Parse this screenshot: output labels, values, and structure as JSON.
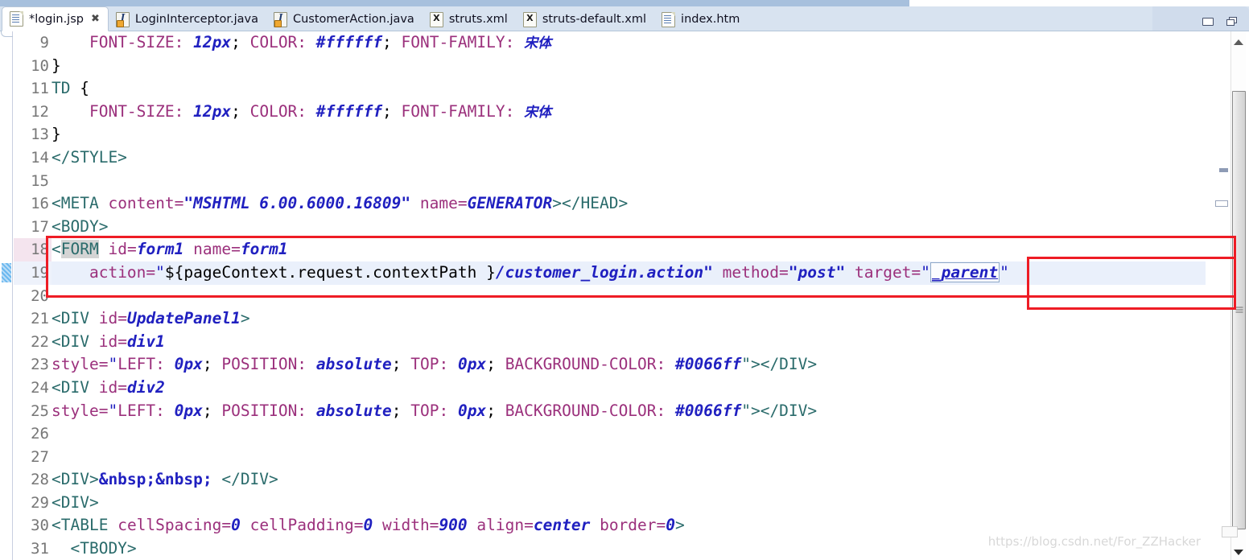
{
  "window": {
    "minimize_label": "Minimize",
    "maximize_label": "Restore"
  },
  "tabs": [
    {
      "label": "*login.jsp",
      "icon": "jsp-file-icon",
      "active": true,
      "close": "✖"
    },
    {
      "label": "LoginInterceptor.java",
      "icon": "java-file-icon",
      "active": false
    },
    {
      "label": "CustomerAction.java",
      "icon": "java-file-icon",
      "active": false
    },
    {
      "label": "struts.xml",
      "icon": "xml-file-icon",
      "active": false
    },
    {
      "label": "struts-default.xml",
      "icon": "xml-file-icon",
      "active": false
    },
    {
      "label": "index.htm",
      "icon": "html-file-icon",
      "active": false
    }
  ],
  "editor": {
    "first_visible_line": 9,
    "current_line": 19,
    "changed_line": 18,
    "lines": [
      {
        "n": "9",
        "fold": false,
        "indent": 3
      },
      {
        "n": "10",
        "fold": false
      },
      {
        "n": "11",
        "fold": false
      },
      {
        "n": "12",
        "fold": false,
        "indent": 3
      },
      {
        "n": "13",
        "fold": false
      },
      {
        "n": "14",
        "fold": false
      },
      {
        "n": "15",
        "fold": false
      },
      {
        "n": "16",
        "fold": false
      },
      {
        "n": "17",
        "fold": true
      },
      {
        "n": "18",
        "fold": true
      },
      {
        "n": "19",
        "fold": false
      },
      {
        "n": "20",
        "fold": false
      },
      {
        "n": "21",
        "fold": true
      },
      {
        "n": "22",
        "fold": true
      },
      {
        "n": "23",
        "fold": false
      },
      {
        "n": "24",
        "fold": true
      },
      {
        "n": "25",
        "fold": false
      },
      {
        "n": "26",
        "fold": false
      },
      {
        "n": "27",
        "fold": false
      },
      {
        "n": "28",
        "fold": false
      },
      {
        "n": "29",
        "fold": true
      },
      {
        "n": "30",
        "fold": true
      },
      {
        "n": "31",
        "fold": true
      }
    ],
    "code": {
      "l9_prop1": "FONT-SIZE:",
      "l9_val1": "12px",
      "l9_semi1": ";",
      "l9_prop2": "COLOR:",
      "l9_val2": "#ffffff",
      "l9_semi2": ";",
      "l9_prop3": "FONT-FAMILY:",
      "l9_val3": "宋体",
      "l10": "}",
      "l11_sel": "TD",
      "l11_brace": "{",
      "l12_prop1": "FONT-SIZE:",
      "l12_val1": "12px",
      "l12_semi1": ";",
      "l12_prop2": "COLOR:",
      "l12_val2": "#ffffff",
      "l12_semi2": ";",
      "l12_prop3": "FONT-FAMILY:",
      "l12_val3": "宋体",
      "l13": "}",
      "l14": "</STYLE>",
      "l15": "",
      "l16_tag": "<META",
      "l16_attr": "content=",
      "l16_val": "\"MSHTML 6.00.6000.16809\"",
      "l16_attr2": "name=",
      "l16_val2": "GENERATOR",
      "l16_close": "></HEAD>",
      "l17": "<BODY>",
      "l18_open": "<",
      "l18_tagname": "FORM",
      "l18_attr1": "id=",
      "l18_val1": "form1",
      "l18_attr2": "name=",
      "l18_val2": "form1",
      "l19_attr": "action=",
      "l19_quote": "\"",
      "l19_el": "${pageContext.request.contextPath }",
      "l19_path": "/customer_login.action\"",
      "l19_attr2": "method=",
      "l19_val2": "\"post\"",
      "l19_attr3": "target=",
      "l19_q1": "\"",
      "l19_val3": "_parent",
      "l19_q2": "\"",
      "l20": "",
      "l21_tag": "<DIV",
      "l21_attr": "id=",
      "l21_val": "UpdatePanel1",
      "l21_gt": ">",
      "l22_tag": "<DIV",
      "l22_attr": "id=",
      "l22_val": "div1",
      "l23_attr": "style=",
      "l23_q": "\"",
      "l23_p1": "LEFT:",
      "l23_v1": "0px",
      "l23_s1": ";",
      "l23_p2": "POSITION:",
      "l23_v2": "absolute",
      "l23_s2": ";",
      "l23_p3": "TOP:",
      "l23_v3": "0px",
      "l23_s3": ";",
      "l23_p4": "BACKGROUND-COLOR:",
      "l23_v4": "#0066ff",
      "l23_end": "\"></DIV>",
      "l24_tag": "<DIV",
      "l24_attr": "id=",
      "l24_val": "div2",
      "l25_attr": "style=",
      "l25_q": "\"",
      "l25_p1": "LEFT:",
      "l25_v1": "0px",
      "l25_s1": ";",
      "l25_p2": "POSITION:",
      "l25_v2": "absolute",
      "l25_s2": ";",
      "l25_p3": "TOP:",
      "l25_v3": "0px",
      "l25_s3": ";",
      "l25_p4": "BACKGROUND-COLOR:",
      "l25_v4": "#0066ff",
      "l25_end": "\"></DIV>",
      "l26": "",
      "l27": "",
      "l28_open": "<DIV>",
      "l28_ent": "&nbsp;&nbsp;",
      "l28_close": " </DIV>",
      "l29": "<DIV>",
      "l30_tag": "<TABLE",
      "l30_a1": "cellSpacing=",
      "l30_v1": "0",
      "l30_a2": "cellPadding=",
      "l30_v2": "0",
      "l30_a3": "width=",
      "l30_v3": "900",
      "l30_a4": "align=",
      "l30_v4": "center",
      "l30_a5": "border=",
      "l30_v5": "0",
      "l30_gt": ">",
      "l31": "<TBODY>"
    }
  },
  "annotations": {
    "box_main_label": "highlighted-form-declaration",
    "box_target_label": "highlighted-target-attribute"
  },
  "watermark": {
    "text": "https://blog.csdn.net/For_ZZHacker"
  },
  "scrollbar": {
    "up_arrow": "scroll-up",
    "down_arrow": "scroll-down"
  },
  "colors": {
    "tag": "#2a6b6b",
    "attribute": "#9b307c",
    "value": "#2020c0",
    "plain": "#000000",
    "annotation_red": "#ee1c25",
    "current_line": "#eaf0fb",
    "tab_bar": "#d8e3f0"
  }
}
